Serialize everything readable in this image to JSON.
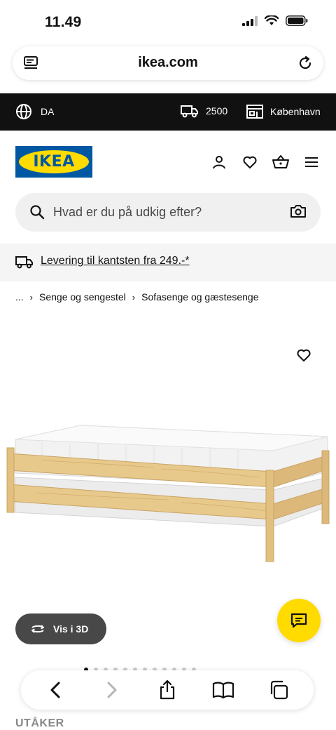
{
  "status": {
    "time": "11.49"
  },
  "browser": {
    "url": "ikea.com"
  },
  "topbar": {
    "language": "DA",
    "postal_code": "2500",
    "store": "København"
  },
  "header": {
    "logo_text": "IKEA"
  },
  "search": {
    "placeholder": "Hvad er du på udkig efter?"
  },
  "delivery": {
    "text": "Levering til kantsten fra 249.-*"
  },
  "breadcrumb": {
    "ellipsis": "...",
    "items": [
      "Senge og sengestel",
      "Sofasenge og gæstesenge"
    ]
  },
  "product": {
    "view_3d_label": "Vis i 3D",
    "name": "UTÅKER",
    "image_count": 12,
    "active_image": 0
  },
  "colors": {
    "brand_blue": "#0058a3",
    "brand_yellow": "#ffdb00",
    "topbar_bg": "#111111"
  },
  "icons": [
    "tabs-icon",
    "reload-icon",
    "globe-icon",
    "truck-icon",
    "store-icon",
    "account-icon",
    "heart-icon",
    "basket-icon",
    "menu-icon",
    "search-icon",
    "camera-icon",
    "rotate-3d-icon",
    "chat-icon",
    "back-icon",
    "forward-icon",
    "share-icon",
    "bookmarks-icon",
    "tabs-overview-icon"
  ]
}
